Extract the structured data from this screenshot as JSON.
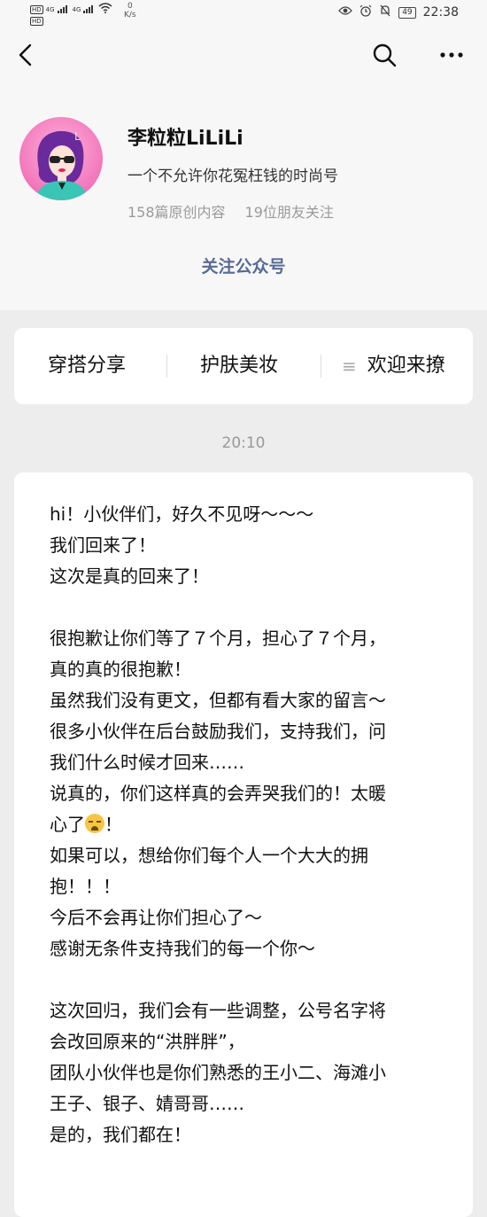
{
  "status_bar": {
    "sim1": "HD",
    "sim2": "HD",
    "net1": "4G",
    "net2": "4G",
    "speed_value": "0",
    "speed_unit": "K/s",
    "battery": "49",
    "time": "22:38"
  },
  "nav": {
    "back_icon": "chevron-left-icon",
    "search_icon": "search-icon",
    "more_icon": "more-horizontal-icon"
  },
  "profile": {
    "name": "李粒粒LiLiLi",
    "description": "一个不允许你花冤枉钱的时尚号",
    "original_count": "158篇原创内容",
    "friends_follow": "19位朋友关注",
    "follow_label": "关注公众号"
  },
  "menu": {
    "items": [
      "穿搭分享",
      "护肤美妆",
      "欢迎来撩"
    ]
  },
  "timestamp": "20:10",
  "article": {
    "p1": [
      "hi！小伙伴们，好久不见呀～～～",
      "我们回来了！",
      "这次是真的回来了！"
    ],
    "p2": [
      "很抱歉让你们等了７个月，担心了７个月，",
      "真的真的很抱歉！",
      "虽然我们没有更文，但都有看大家的留言～",
      "很多小伙伴在后台鼓励我们，支持我们，问",
      "我们什么时候才回来……",
      "说真的，你们这样真的会弄哭我们的！太暖"
    ],
    "p2_emoji_line_start": "心了",
    "p2_emoji_line_end": "！",
    "p2b": [
      "如果可以，想给你们每个人一个大大的拥",
      "抱！！！",
      "今后不会再让你们担心了～",
      "感谢无条件支持我们的每一个你～"
    ],
    "p3": [
      "这次回归，我们会有一些调整，公号名字将",
      "会改回原来的“洪胖胖”，",
      "团队小伙伴也是你们熟悉的王小二、海滩小",
      "王子、银子、婧哥哥……",
      "是的，我们都在！"
    ]
  }
}
